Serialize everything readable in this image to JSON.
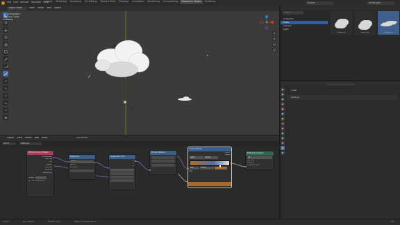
{
  "topbar": {
    "menus": [
      "File",
      "Edit",
      "Render",
      "Window",
      "Help"
    ],
    "workspaces": [
      "Layout",
      "Modeling",
      "Sculpting",
      "UV Editing",
      "Texture Paint",
      "Shading",
      "Animation",
      "Rendering",
      "Compositing",
      "Geometry Nodes",
      "Scripting"
    ],
    "active_workspace": "Geometry Nodes",
    "scene_label": "Scene",
    "viewlayer_label": "ViewLayer"
  },
  "viewport": {
    "mode": "Object Mode",
    "menus": [
      "View",
      "Select",
      "Add",
      "Object"
    ],
    "overlay_lines": [
      "Top Orthographic",
      "(1) Cube | Cube",
      "10 Meters"
    ],
    "shading": "Material Preview"
  },
  "node_editor": {
    "menus": [
      "Object",
      "View",
      "Select",
      "Add",
      "Node"
    ],
    "use_nodes_label": "Use Nodes",
    "slot_label": "Slot 1",
    "material_name": "Material",
    "nodes": {
      "texcoord": {
        "title": "Texture Coordinate",
        "outputs": [
          "Generated",
          "Normal",
          "UV",
          "Object",
          "Camera",
          "Window",
          "Reflection"
        ],
        "object_label": "Object",
        "from_instancer": "From Instancer"
      },
      "mapping": {
        "title": "Mapping",
        "type": "Point",
        "fields": [
          "Vector",
          "Location"
        ]
      },
      "separate": {
        "title": "Separate XYZ",
        "outputs": [
          "X",
          "Y",
          "Z"
        ]
      },
      "math": {
        "title": "Math",
        "fields": [
          "Multiply",
          "Value",
          "Value"
        ]
      },
      "noise": {
        "title": "Noise Texture"
      },
      "ramp": {
        "title": "Color Ramp",
        "mode": "RGB",
        "interp": "Linear",
        "pos_label": "Pos",
        "pos_value": "0.500",
        "outputs": [
          "Color",
          "Alpha"
        ],
        "input": "Fac"
      },
      "output": {
        "title": "Material Output",
        "target": "All",
        "inputs": [
          "Surface",
          "Volume",
          "Displacement"
        ]
      }
    }
  },
  "outliner": {
    "search_placeholder": "Search",
    "items": [
      "Collection",
      "Cube",
      "Camera",
      "Light"
    ],
    "selected": "Cube"
  },
  "asset_browser": {
    "thumbs": [
      "Cloud_01",
      "Cloud_02",
      "Cloud_03"
    ]
  },
  "properties": {
    "object_name": "Cube",
    "panel_label": "Settings",
    "tab_icons": [
      "tool-icon",
      "render-icon",
      "output-icon",
      "view-layer-icon",
      "scene-icon",
      "world-icon",
      "object-icon",
      "modifier-icon",
      "particles-icon",
      "physics-icon",
      "constraints-icon",
      "data-icon",
      "material-icon",
      "texture-icon"
    ]
  },
  "status": {
    "items": [
      "Select",
      "Box Select",
      "Rotate View",
      "Object Context Menu"
    ],
    "version": "3.6"
  },
  "colors": {
    "accent": "#4b6fa8",
    "selected_row": "#355c9a",
    "node_red": "#a2405a",
    "node_blue": "#3a5f8a",
    "node_green": "#2d6a4f",
    "grid_line": "#444444",
    "y_axis": "#6e8f2a"
  }
}
